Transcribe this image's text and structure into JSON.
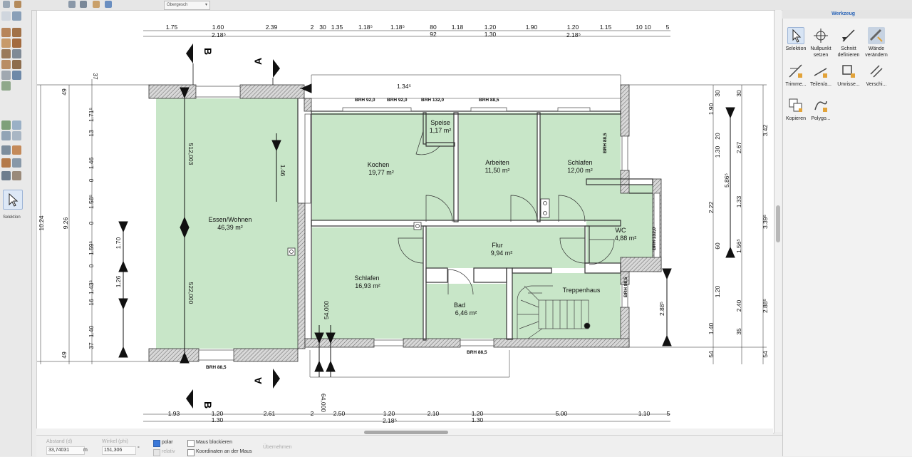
{
  "topbar": {
    "floor": "Obergesch",
    "dropdown_arrow": "▾"
  },
  "left_toolbar": {
    "selected_tool_label": "Selektion"
  },
  "right_panel": {
    "title": "Werkzeug",
    "tools": [
      {
        "label": "Selektion"
      },
      {
        "label": "Nullpunkt setzen"
      },
      {
        "label": "Schnitt definieren"
      },
      {
        "label": "Wände verändern"
      },
      {
        "label": "Trimme..."
      },
      {
        "label": "Teilen/a..."
      },
      {
        "label": "Umrisse..."
      },
      {
        "label": "Verschi..."
      },
      {
        "label": "Kopieren"
      },
      {
        "label": "Polygo..."
      }
    ]
  },
  "status": {
    "distance_label": "Abstand (d)",
    "distance_value": "33,74031",
    "distance_unit": "m",
    "angle_label": "Winkel (phi)",
    "angle_value": "151,306",
    "angle_unit": "°",
    "polar_label": "polar",
    "relativ_label": "relativ",
    "block_mouse_label": "Maus blockieren",
    "coords_mouse_label": "Koordinaten an der Maus",
    "apply_label": "Übernehmen"
  },
  "plan": {
    "rooms": [
      {
        "name": "Essen/Wohnen",
        "area": "46,39 m²"
      },
      {
        "name": "Kochen",
        "area": "19,77 m²"
      },
      {
        "name": "Speise",
        "area": "1,17 m²"
      },
      {
        "name": "Arbeiten",
        "area": "11,50 m²"
      },
      {
        "name": "Schlafen",
        "area": "12,00 m²"
      },
      {
        "name": "WC",
        "area": "4,88 m²"
      },
      {
        "name": "Flur",
        "area": "9,94 m²"
      },
      {
        "name": "Schlafen",
        "area": "16,93 m²"
      },
      {
        "name": "Bad",
        "area": "6,46 m²"
      },
      {
        "name": "Treppenhaus",
        "area": ""
      }
    ],
    "window_labels": [
      "BRH 92,0",
      "BRH 92,0",
      "BRH 132,0",
      "BRH 88,5",
      "BRH 88,5",
      "BRH 88,5",
      "BRH 88,5",
      "BRH 132,0",
      "BRH 88,5"
    ],
    "section_labels": [
      "B",
      "A",
      "A",
      "B"
    ],
    "top_dims": [
      "1.75",
      "1.60",
      "2.18⁵",
      "2.39",
      "2",
      "30",
      "1.35",
      "1.18⁵",
      "1.18⁵",
      "80",
      "92",
      "1.18",
      "1.20",
      "1.30",
      "1.90",
      "1.20",
      "2.18⁵",
      "1.15",
      "10",
      "10",
      "5"
    ],
    "bottom_dims": [
      "1.93",
      "1.20",
      "1.30",
      "2.61",
      "2",
      "2.50",
      "1.20",
      "2.18⁵",
      "2.10",
      "1.20",
      "1.30",
      "5.00",
      "1.10",
      "5"
    ],
    "left_dims": [
      "37",
      "49",
      "1.71⁵",
      "13",
      "1.46",
      "0",
      "1.58⁵",
      "0",
      "1.59⁵",
      "0",
      "1.43⁵",
      "16",
      "1.40",
      "37",
      "49",
      "10.24",
      "9.26"
    ],
    "right_dims": [
      "1.90",
      "3.42",
      "2.67",
      "1.30",
      "5.86⁵",
      "2.22",
      "1.33",
      "3.39⁵",
      "1.56⁵",
      "1.20",
      "2.88⁵",
      "2.40",
      "1.40",
      "35",
      "54",
      "54",
      "30",
      "30"
    ],
    "inner_dims": [
      "512,003",
      "522,000",
      "1.46",
      "1.70",
      "1.26",
      "54,000",
      "64,000",
      "1.34⁵",
      "2.88⁵",
      "20",
      "60"
    ]
  }
}
